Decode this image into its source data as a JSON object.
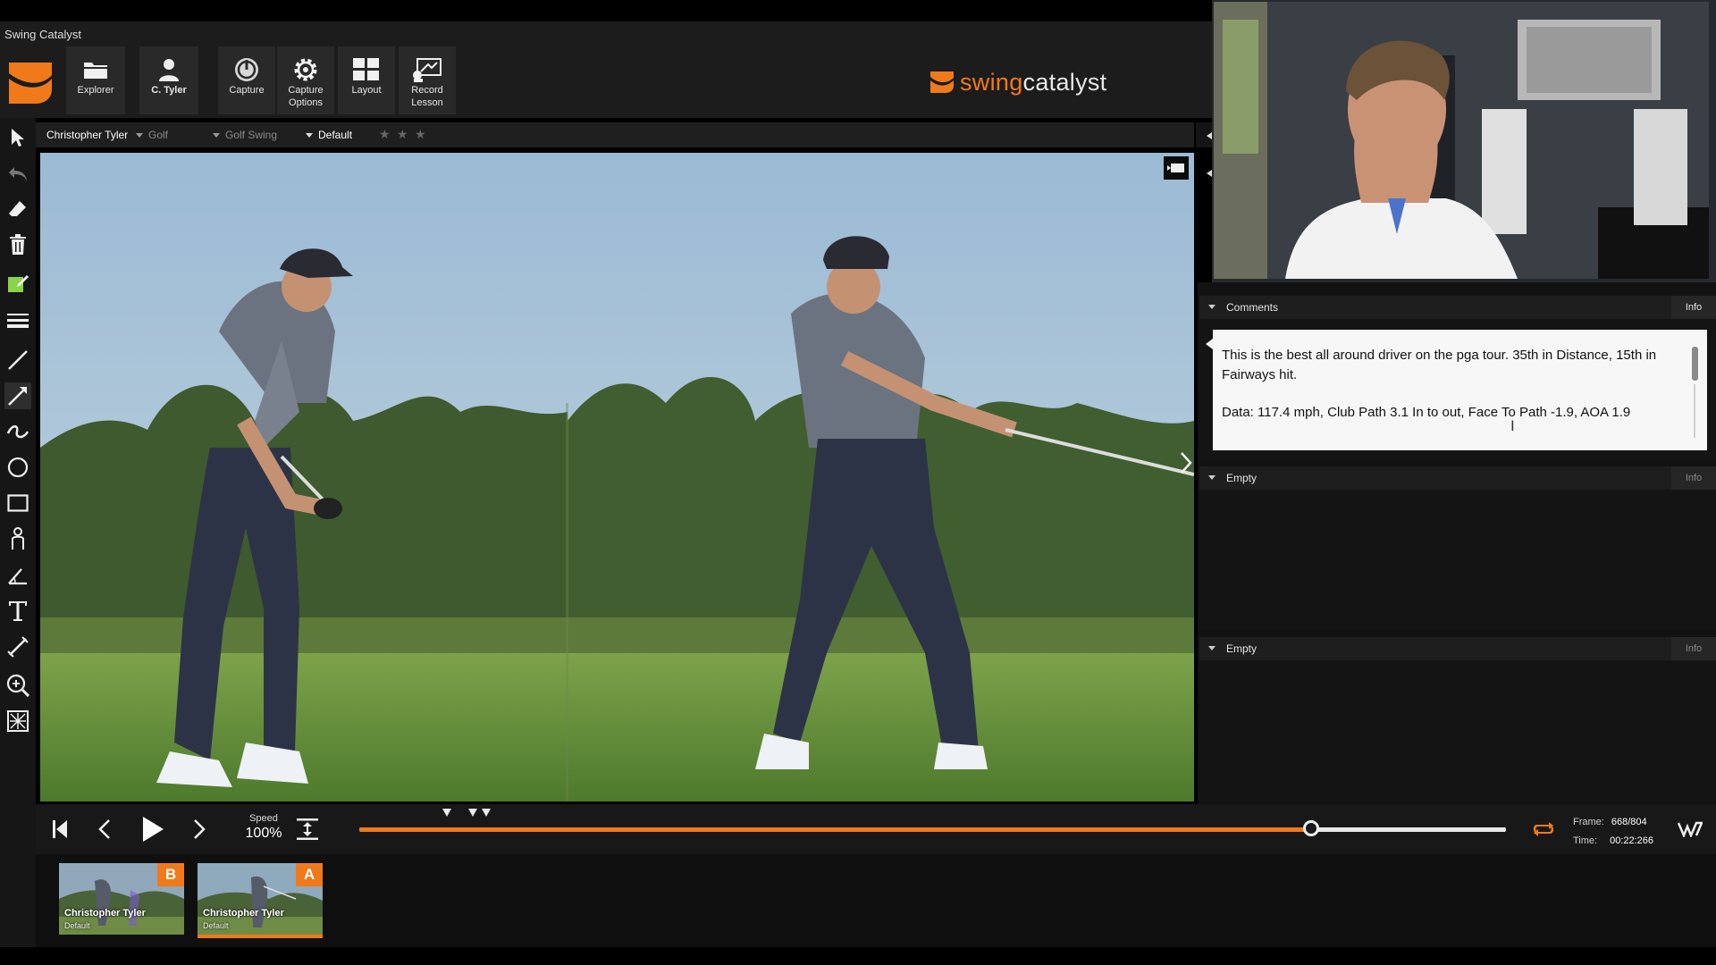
{
  "app": {
    "title": "Swing Catalyst"
  },
  "toolbar": {
    "explorer": "Explorer",
    "user": "C. Tyler",
    "capture": "Capture",
    "capture_options_1": "Capture",
    "capture_options_2": "Options",
    "layout": "Layout",
    "record_lesson_1": "Record",
    "record_lesson_2": "Lesson"
  },
  "brand": {
    "part1": "swing",
    "part2": "catalyst"
  },
  "video_header": {
    "player": "Christopher Tyler",
    "sport": "Golf",
    "category": "Golf Swing",
    "view": "Default",
    "stars": [
      "★",
      "★",
      "★"
    ]
  },
  "panels": {
    "comments": {
      "title": "Comments",
      "info": "Info",
      "text_line1": "This is the best all around driver on the pga tour. 35th in Distance, 15th in Fairways hit.",
      "text_line2": "Data: 117.4 mph, Club Path 3.1 In to out, Face To Path -1.9, AOA 1.9"
    },
    "empty1": {
      "title": "Empty",
      "info": "Info"
    },
    "empty2": {
      "title": "Empty",
      "info": "Info"
    }
  },
  "transport": {
    "speed_label": "Speed",
    "speed_value": "100%",
    "progress": 0.83,
    "frame_label": "Frame:",
    "frame_value": "668/804",
    "time_label": "Time:",
    "time_value": "00:22:266"
  },
  "thumbnails": [
    {
      "letter": "B",
      "name": "Christopher Tyler",
      "view": "Default",
      "selected": false
    },
    {
      "letter": "A",
      "name": "Christopher Tyler",
      "view": "Default",
      "selected": true
    }
  ],
  "colors": {
    "accent": "#f07a1a",
    "panel": "#1e1e1e",
    "background": "#121212"
  }
}
